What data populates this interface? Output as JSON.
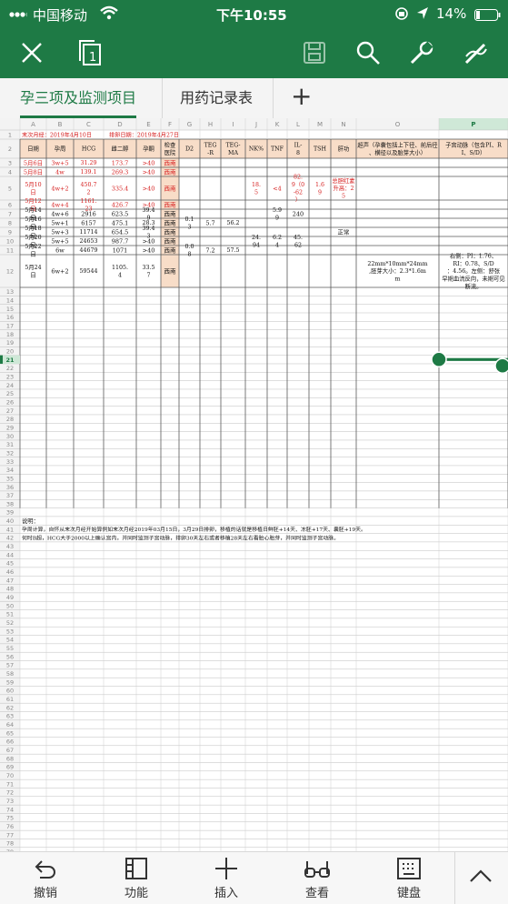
{
  "status_bar": {
    "carrier": "中国移动",
    "time": "下午10:55",
    "battery": "14%"
  },
  "toolbar": {
    "icons": [
      "close-icon",
      "window-icon",
      "save-icon",
      "search-icon",
      "wrench-icon",
      "pen-icon"
    ]
  },
  "tabs": [
    {
      "label": "孕三项及监测项目",
      "active": true
    },
    {
      "label": "用药记录表",
      "active": false
    }
  ],
  "add_tab_label": "+",
  "sheet": {
    "col_letters": [
      "A",
      "B",
      "C",
      "D",
      "E",
      "F",
      "G",
      "H",
      "I",
      "J",
      "K",
      "L",
      "M",
      "N",
      "O",
      "P"
    ],
    "selected_col": "P",
    "selected_row": "21",
    "row1": {
      "last_period": "末次月经：2019年4月10日",
      "ovulation": "排卵日期：2019年4月27日"
    },
    "headers": [
      "日期",
      "孕周",
      "HCG",
      "雌二醇",
      "孕酮",
      "检查医院",
      "D2",
      "TEG-R",
      "TEG-MA",
      "NK%",
      "TNF",
      "IL-8",
      "TSH",
      "肝功",
      "超声（孕囊包括上下径、前后径、横径以及胎芽大小）",
      "子宫动脉（包含PI、RI、S/D）"
    ],
    "rows": [
      {
        "num": "3",
        "red": true,
        "cells": [
          "5月6日",
          "3w+5",
          "31.29",
          "173.7",
          ">40",
          "西南",
          "",
          "",
          "",
          "",
          "",
          "",
          "",
          "",
          "",
          ""
        ]
      },
      {
        "num": "4",
        "red": true,
        "cells": [
          "5月8日",
          "4w",
          "139.1",
          "269.3",
          ">40",
          "西南",
          "",
          "",
          "",
          "",
          "",
          "",
          "",
          "",
          "",
          ""
        ]
      },
      {
        "num": "5",
        "red": true,
        "cells": [
          "5月10日",
          "4w+2",
          "450.72",
          "335.4",
          ">40",
          "西南",
          "",
          "",
          "",
          "18.5",
          "<4",
          "82.9（0-62）",
          "1.69",
          "总胆红素升高：25",
          "",
          ""
        ]
      },
      {
        "num": "6",
        "red": true,
        "cells": [
          "5月12日",
          "4w+4",
          "1161.23",
          "426.7",
          ">40",
          "西南",
          "",
          "",
          "",
          "",
          "",
          "",
          "",
          "",
          "",
          ""
        ]
      },
      {
        "num": "7",
        "red": false,
        "cells": [
          "5月14日",
          "4w+6",
          "2916",
          "623.5",
          "39.49",
          "西南",
          "",
          "",
          "",
          "",
          "5.99",
          "240",
          "",
          "",
          "",
          ""
        ]
      },
      {
        "num": "8",
        "red": false,
        "cells": [
          "5月16日",
          "5w+1",
          "6157",
          "475.1",
          "28.3",
          "西南",
          "0.13",
          "5.7",
          "56.2",
          "",
          "",
          "",
          "",
          "",
          "",
          ""
        ]
      },
      {
        "num": "9",
        "red": false,
        "cells": [
          "5月18日",
          "5w+3",
          "11714",
          "654.5",
          "39.43",
          "西南",
          "",
          "",
          "",
          "",
          "",
          "",
          "",
          "正常",
          "",
          ""
        ]
      },
      {
        "num": "10",
        "red": false,
        "cells": [
          "5月20日",
          "5w+5",
          "24653",
          "987.7",
          ">40",
          "西南",
          "",
          "",
          "",
          "24.94",
          "6.24",
          "45.62",
          "",
          "",
          "",
          ""
        ]
      },
      {
        "num": "11",
        "red": false,
        "cells": [
          "5月22日",
          "6w",
          "44679",
          "1071",
          ">40",
          "西南",
          "0.08",
          "7.2",
          "57.5",
          "",
          "",
          "",
          "",
          "",
          "",
          ""
        ]
      },
      {
        "num": "12",
        "red": false,
        "cells": [
          "5月24日",
          "6w+2",
          "59544",
          "1105.4",
          "33.57",
          "西南",
          "",
          "",
          "",
          "",
          "",
          "",
          "",
          "",
          "22mm*10mm*24mm,胚芽大小：2.3*1.6mm",
          "右侧：PI：1.76、RI：0.78、S/D：4.56。左侧：舒张早期血流反向，未期可见断流。"
        ]
      }
    ],
    "note_label": "说明：",
    "note_line1": "孕周计算，自怀从末次月经开始算例如末次月经2019年03月15日，3月29日排卵，移植的话就是移植日鲜胚+14天、冻胚+17天、囊胚+19天。",
    "note_line2": "何时B超，HCG大于2000以上确认宫内，并同时监测子宫动脉，排卵30天左右或者移植28天左右看胎心胎芽，并同时监测子宫动脉。"
  },
  "bottom_bar": [
    {
      "label": "撤销",
      "icon": "undo-icon"
    },
    {
      "label": "功能",
      "icon": "layout-icon"
    },
    {
      "label": "插入",
      "icon": "plus-icon"
    },
    {
      "label": "查看",
      "icon": "glasses-icon"
    },
    {
      "label": "键盘",
      "icon": "keyboard-icon"
    }
  ],
  "colors": {
    "brand": "#1e7a45",
    "red_text": "#d62020",
    "header_fill": "#f8ddc8",
    "selection": "#1e7a45"
  }
}
